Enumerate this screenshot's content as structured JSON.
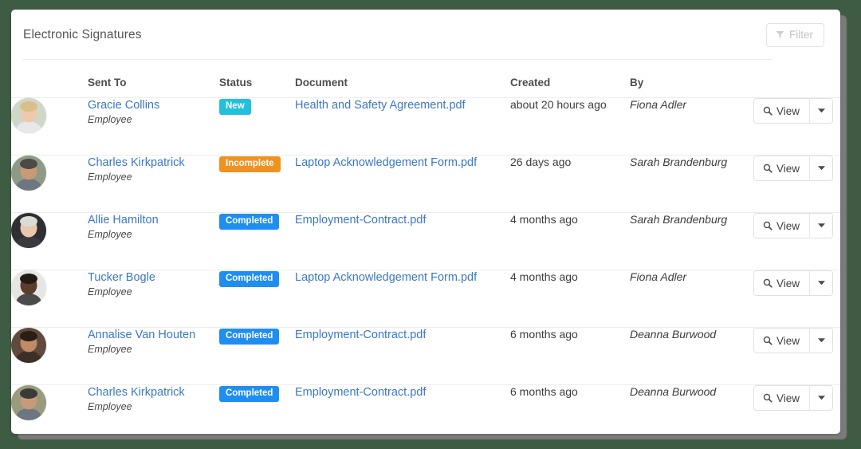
{
  "background_color": "#3e5c43",
  "card": {
    "title": "Electronic Signatures",
    "filter_button": {
      "label": "Filter",
      "icon": "funnel-icon",
      "disabled": true
    }
  },
  "colors": {
    "link": "#3b78c3",
    "badge_new": "#23c0de",
    "badge_incomplete": "#f0921f",
    "badge_completed": "#1f8ef1",
    "header_text": "#4d4d4d",
    "title_text": "#545454",
    "row_border": "#ededed"
  },
  "table": {
    "columns": [
      {
        "key": "avatar",
        "label": ""
      },
      {
        "key": "sent_to",
        "label": "Sent To"
      },
      {
        "key": "status",
        "label": "Status"
      },
      {
        "key": "document",
        "label": "Document"
      },
      {
        "key": "created",
        "label": "Created"
      },
      {
        "key": "by",
        "label": "By"
      },
      {
        "key": "actions",
        "label": ""
      }
    ],
    "action_button": {
      "label": "View",
      "icon": "magnifier-icon",
      "caret_icon": "caret-down-icon"
    },
    "rows": [
      {
        "name": "Gracie Collins",
        "role": "Employee",
        "avatar": "avatar-photo-gracie-collins",
        "status": "New",
        "status_type": "new",
        "document": "Health and Safety Agreement.pdf",
        "created": "about 20 hours ago",
        "by": "Fiona Adler"
      },
      {
        "name": "Charles Kirkpatrick",
        "role": "Employee",
        "avatar": "avatar-photo-charles-kirkpatrick",
        "status": "Incomplete",
        "status_type": "incomplete",
        "document": "Laptop Acknowledgement Form.pdf",
        "created": "26 days ago",
        "by": "Sarah Brandenburg"
      },
      {
        "name": "Allie Hamilton",
        "role": "Employee",
        "avatar": "avatar-photo-allie-hamilton",
        "status": "Completed",
        "status_type": "completed",
        "document": "Employment-Contract.pdf",
        "created": "4 months ago",
        "by": "Sarah Brandenburg"
      },
      {
        "name": "Tucker Bogle",
        "role": "Employee",
        "avatar": "avatar-photo-tucker-bogle",
        "status": "Completed",
        "status_type": "completed",
        "document": "Laptop Acknowledgement Form.pdf",
        "created": "4 months ago",
        "by": "Fiona Adler"
      },
      {
        "name": "Annalise Van Houten",
        "role": "Employee",
        "avatar": "avatar-photo-annalise-van-houten",
        "status": "Completed",
        "status_type": "completed",
        "document": "Employment-Contract.pdf",
        "created": "6 months ago",
        "by": "Deanna Burwood"
      },
      {
        "name": "Charles Kirkpatrick",
        "role": "Employee",
        "avatar": "avatar-photo-charles-kirkpatrick",
        "status": "Completed",
        "status_type": "completed",
        "document": "Employment-Contract.pdf",
        "created": "6 months ago",
        "by": "Deanna Burwood"
      }
    ]
  }
}
